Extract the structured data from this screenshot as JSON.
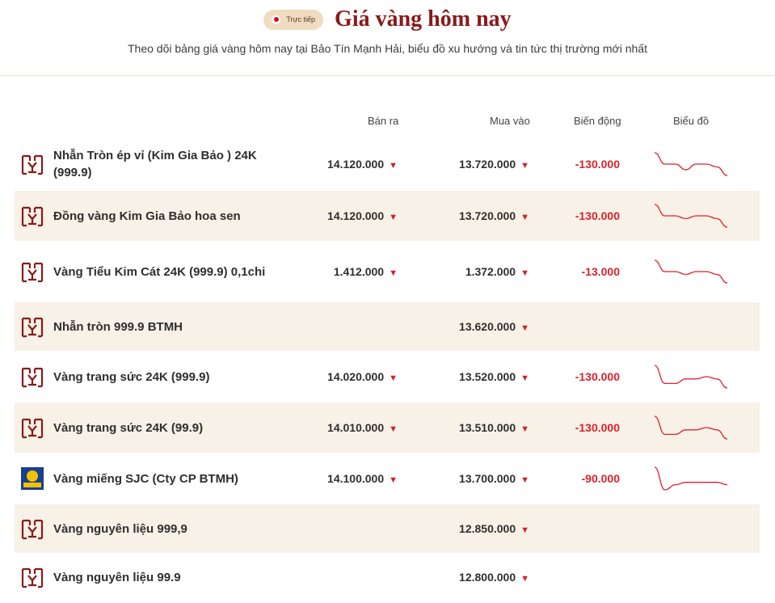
{
  "header": {
    "live_label": "Trực tiếp",
    "title": "Giá vàng hôm nay",
    "subtitle": "Theo dõi bảng giá vàng hôm nay tại Bảo Tín Mạnh Hải, biểu đồ xu hướng và tin tức thị trường mới nhất"
  },
  "columns": {
    "sell": "Bán ra",
    "buy": "Mua vào",
    "change": "Biến động",
    "chart": "Biểu đồ"
  },
  "trend_icon": "down-triangle",
  "colors": {
    "brand": "#8a1a1a",
    "down": "#d9232d",
    "row_alt": "#f8f1e8",
    "badge": "#f0dcbf"
  },
  "rows": [
    {
      "logo": "btmh-logo",
      "name": "Nhẫn Tròn ép vỉ (Kim Gia Bảo ) 24K (999.9)",
      "sell": "14.120.000",
      "buy": "13.720.000",
      "change": "-130.000",
      "spark": [
        10,
        6,
        6,
        4,
        6,
        6,
        5,
        2
      ]
    },
    {
      "logo": "btmh-logo",
      "name": "Đồng vàng Kim Gia Bảo hoa sen",
      "sell": "14.120.000",
      "buy": "13.720.000",
      "change": "-130.000",
      "spark": [
        10,
        6,
        6,
        5,
        6,
        6,
        5,
        2
      ]
    },
    {
      "logo": "btmh-logo",
      "name": "Vàng Tiểu Kim Cát 24K (999.9) 0,1chi",
      "sell": "1.412.000",
      "buy": "1.372.000",
      "change": "-13.000",
      "spark": [
        10,
        6,
        6,
        5,
        6,
        6,
        5,
        2
      ]
    },
    {
      "logo": "btmh-logo",
      "name": "Nhẫn tròn 999.9 BTMH",
      "sell": "",
      "buy": "13.620.000",
      "change": "",
      "spark": []
    },
    {
      "logo": "btmh-logo",
      "name": "Vàng trang sức 24K (999.9)",
      "sell": "14.020.000",
      "buy": "13.520.000",
      "change": "-130.000",
      "spark": [
        10,
        2,
        2,
        4,
        4,
        5,
        4,
        0
      ]
    },
    {
      "logo": "btmh-logo",
      "name": "Vàng trang sức 24K (99.9)",
      "sell": "14.010.000",
      "buy": "13.510.000",
      "change": "-130.000",
      "spark": [
        10,
        2,
        2,
        4,
        4,
        5,
        4,
        0
      ]
    },
    {
      "logo": "sjc-logo",
      "name": "Vàng miếng SJC (Cty CP BTMH)",
      "sell": "14.100.000",
      "buy": "13.700.000",
      "change": "-90.000",
      "spark": [
        10,
        1,
        3,
        4,
        4,
        4,
        4,
        3
      ]
    },
    {
      "logo": "btmh-logo",
      "name": "Vàng nguyên liệu 999,9",
      "sell": "",
      "buy": "12.850.000",
      "change": "",
      "spark": []
    },
    {
      "logo": "btmh-logo",
      "name": "Vàng nguyên liệu 99.9",
      "sell": "",
      "buy": "12.800.000",
      "change": "",
      "spark": []
    }
  ]
}
